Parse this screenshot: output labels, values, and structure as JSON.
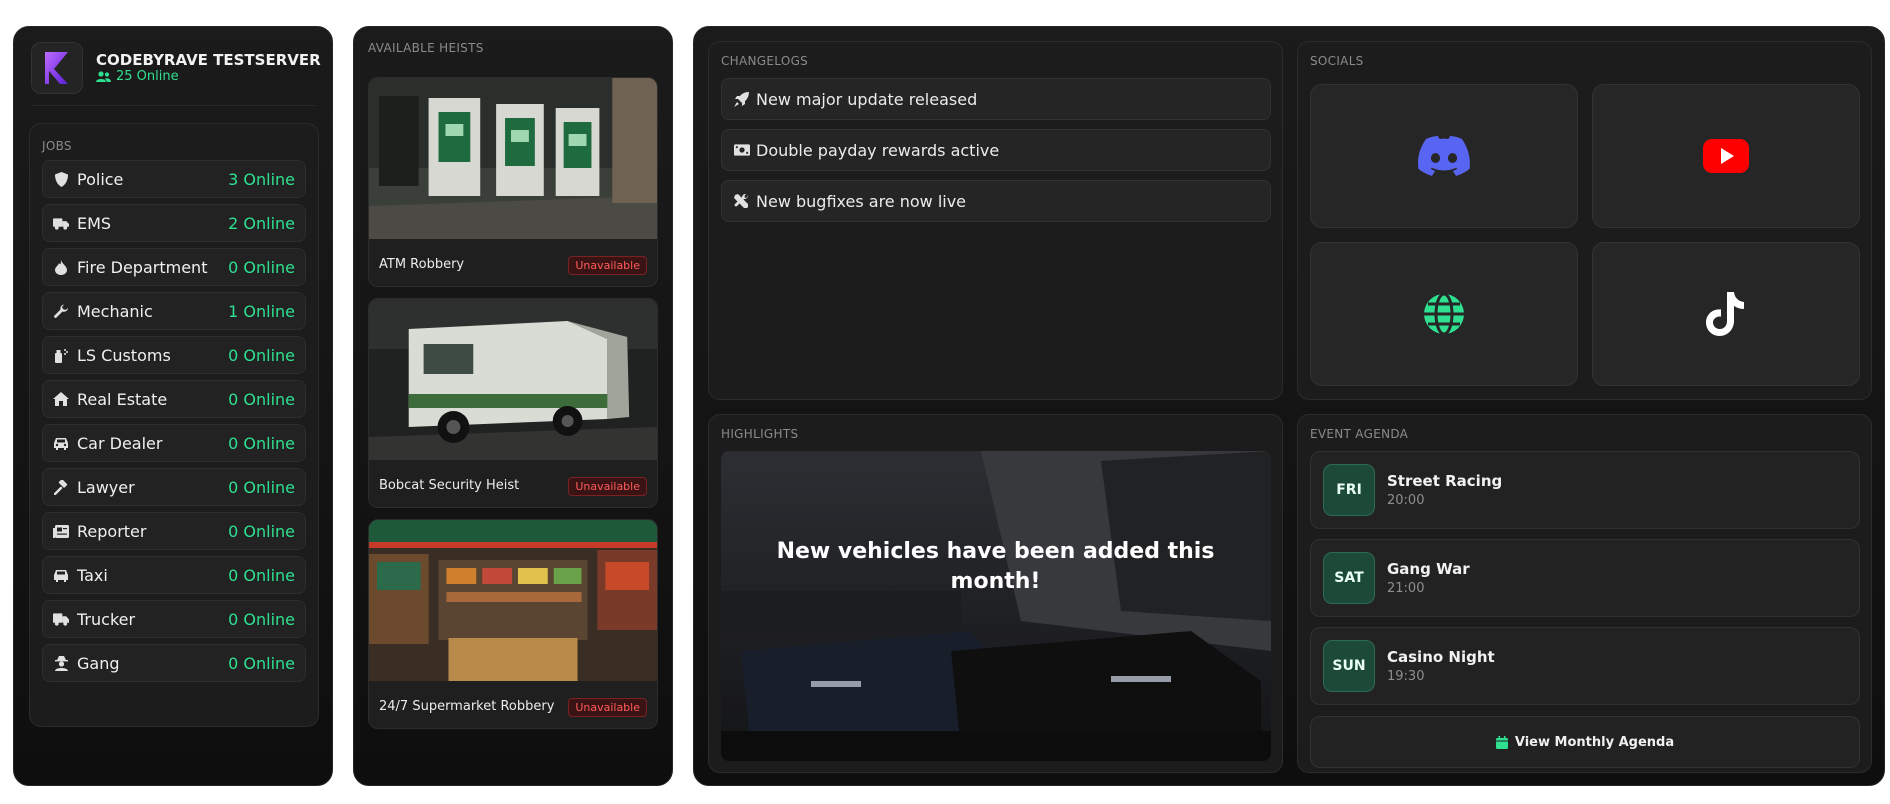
{
  "server": {
    "name": "CODEBYRAVE TESTSERVER",
    "online": "25 Online"
  },
  "jobs": {
    "title": "JOBS",
    "items": [
      {
        "name": "Police",
        "count": "3 Online",
        "icon": "shield-icon"
      },
      {
        "name": "EMS",
        "count": "2 Online",
        "icon": "ambulance-icon"
      },
      {
        "name": "Fire Department",
        "count": "0 Online",
        "icon": "fire-icon"
      },
      {
        "name": "Mechanic",
        "count": "1 Online",
        "icon": "wrench-icon"
      },
      {
        "name": "LS Customs",
        "count": "0 Online",
        "icon": "spray-can-icon"
      },
      {
        "name": "Real Estate",
        "count": "0 Online",
        "icon": "house-icon"
      },
      {
        "name": "Car Dealer",
        "count": "0 Online",
        "icon": "car-icon"
      },
      {
        "name": "Lawyer",
        "count": "0 Online",
        "icon": "gavel-icon"
      },
      {
        "name": "Reporter",
        "count": "0 Online",
        "icon": "newspaper-icon"
      },
      {
        "name": "Taxi",
        "count": "0 Online",
        "icon": "taxi-icon"
      },
      {
        "name": "Trucker",
        "count": "0 Online",
        "icon": "truck-icon"
      },
      {
        "name": "Gang",
        "count": "0 Online",
        "icon": "user-secret-icon"
      }
    ]
  },
  "heists": {
    "title": "AVAILABLE HEISTS",
    "items": [
      {
        "name": "ATM Robbery",
        "status": "Unavailable"
      },
      {
        "name": "Bobcat Security Heist",
        "status": "Unavailable"
      },
      {
        "name": "24/7 Supermarket Robbery",
        "status": "Unavailable"
      }
    ]
  },
  "changelogs": {
    "title": "CHANGELOGS",
    "items": [
      {
        "text": "New major update released",
        "icon": "rocket-icon"
      },
      {
        "text": "Double payday rewards active",
        "icon": "money-bill-icon"
      },
      {
        "text": "New bugfixes are now live",
        "icon": "tools-icon"
      }
    ]
  },
  "socials": {
    "title": "SOCIALS",
    "items": [
      {
        "name": "discord",
        "icon": "discord-icon",
        "color": "#5865f2"
      },
      {
        "name": "youtube",
        "icon": "youtube-icon",
        "color": "#ff0000"
      },
      {
        "name": "website",
        "icon": "globe-icon",
        "color": "#2ee08f"
      },
      {
        "name": "tiktok",
        "icon": "tiktok-icon",
        "color": "#ffffff"
      }
    ]
  },
  "highlights": {
    "title": "HIGHLIGHTS",
    "text": "New vehicles have been added this month!"
  },
  "agenda": {
    "title": "EVENT AGENDA",
    "items": [
      {
        "day": "FRI",
        "name": "Street Racing",
        "time": "20:00"
      },
      {
        "day": "SAT",
        "name": "Gang War",
        "time": "21:00"
      },
      {
        "day": "SUN",
        "name": "Casino Night",
        "time": "19:30"
      }
    ],
    "button": "View Monthly Agenda"
  },
  "colors": {
    "accent_green": "#2ee08f",
    "danger_red": "#ff5a5a",
    "logo_purple": "#8b3dff"
  }
}
